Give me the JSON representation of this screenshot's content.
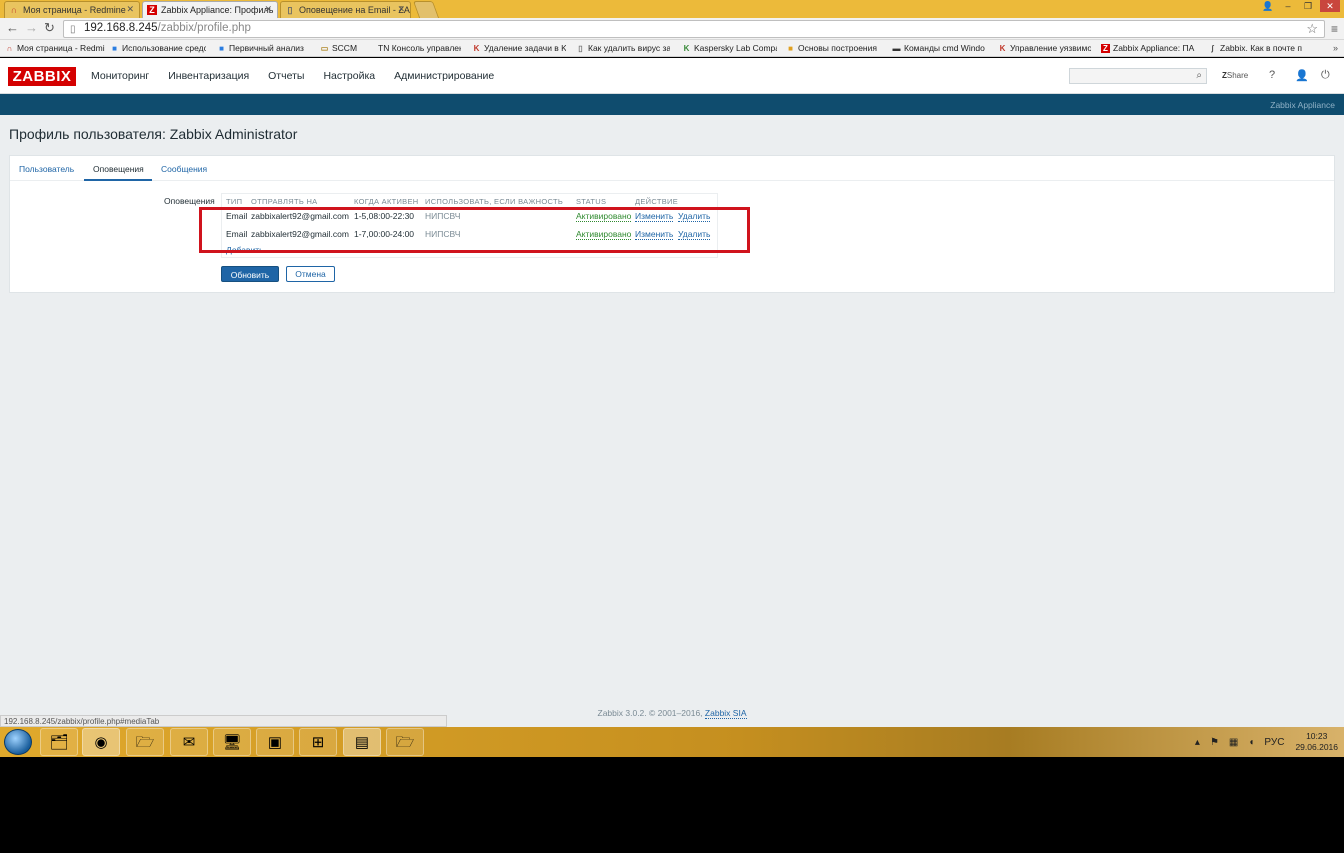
{
  "browser": {
    "tabs": [
      {
        "label": "Моя страница - Redmine",
        "icon": "redmine-icon"
      },
      {
        "label": "Zabbix Appliance: Профиль",
        "icon": "zabbix-icon"
      },
      {
        "label": "Оповещение на Email - ZABBIX",
        "icon": "page-icon"
      }
    ],
    "url_host": "192.168.8.245",
    "url_path": "/zabbix/profile.php",
    "bookmarks": [
      "Моя страница - Redmine",
      "Использование средств",
      "Первичный анализ",
      "SCCM",
      "TN Консоль управления",
      "Удаление задачи в K",
      "Как удалить вирус за",
      "Kaspersky Lab Compa",
      "Основы построения",
      "Команды cmd Windo",
      "Управление уязвимо",
      "Zabbix Appliance: ПА",
      "Zabbix. Как в почте п"
    ],
    "status_url": "192.168.8.245/zabbix/profile.php#mediaTab"
  },
  "zabbix": {
    "logo": "ZABBIX",
    "menu": [
      "Мониторинг",
      "Инвентаризация",
      "Отчеты",
      "Настройка",
      "Администрирование"
    ],
    "share_label": "Share",
    "server_name": "Zabbix Appliance",
    "page_title": "Профиль пользователя: Zabbix Administrator",
    "tabs": [
      "Пользователь",
      "Оповещения",
      "Сообщения"
    ],
    "media_label": "Оповещения",
    "table": {
      "headers": [
        "ТИП",
        "ОТПРАВЛЯТЬ НА",
        "КОГДА АКТИВЕН",
        "ИСПОЛЬЗОВАТЬ, ЕСЛИ ВАЖНОСТЬ",
        "STATUS",
        "ДЕЙСТВИЕ"
      ],
      "rows": [
        {
          "type": "Email",
          "send_to": "zabbixalert92@gmail.com",
          "when": "1-5,08:00-22:30",
          "severity": "НИПСВЧ",
          "status": "Активировано",
          "edit": "Изменить",
          "delete": "Удалить"
        },
        {
          "type": "Email",
          "send_to": "zabbixalert92@gmail.com",
          "when": "1-7,00:00-24:00",
          "severity": "НИПСВЧ",
          "status": "Активировано",
          "edit": "Изменить",
          "delete": "Удалить"
        }
      ],
      "add_label": "Добавить"
    },
    "update_button": "Обновить",
    "cancel_button": "Отмена",
    "footer_text": "Zabbix 3.0.2. © 2001–2016,",
    "footer_link": "Zabbix SIA"
  },
  "taskbar": {
    "language": "РУС",
    "time": "10:23",
    "date": "29.06.2016"
  },
  "colors": {
    "zabbix_red": "#d40000",
    "zabbix_header": "#0f4c6e",
    "link_blue": "#1f65a6",
    "highlight_red": "#d0131d"
  }
}
